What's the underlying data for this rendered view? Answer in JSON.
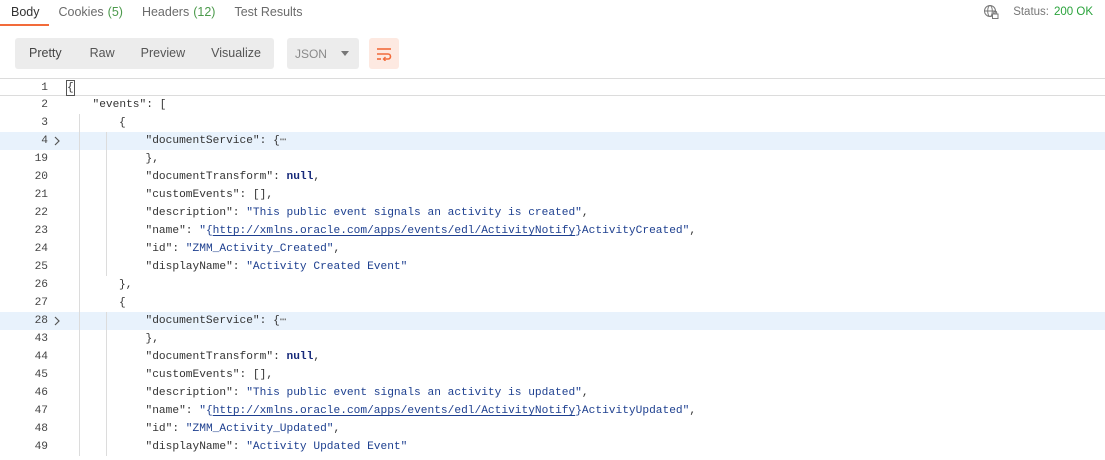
{
  "tabs": [
    {
      "label": "Body",
      "count": "",
      "active": true
    },
    {
      "label": "Cookies",
      "count": "(5)",
      "active": false
    },
    {
      "label": "Headers",
      "count": "(12)",
      "active": false
    },
    {
      "label": "Test Results",
      "count": "",
      "active": false
    }
  ],
  "status": {
    "label": "Status:",
    "value": "200 OK"
  },
  "toolbar": {
    "views": [
      "Pretty",
      "Raw",
      "Preview",
      "Visualize"
    ],
    "format": "JSON",
    "wrap_icon": "wrap-lines-icon"
  },
  "colors": {
    "accent": "#f26b3a",
    "status_ok": "#2aa33c",
    "string": "#1d3f8f",
    "highlight": "#e8f2fc"
  },
  "lines": [
    {
      "num": "1",
      "indent": 0,
      "parts": [
        [
          "cur",
          "{"
        ]
      ]
    },
    {
      "num": "2",
      "indent": 1,
      "parts": [
        [
          "key",
          "\"events\""
        ],
        [
          "p",
          ": ["
        ]
      ]
    },
    {
      "num": "3",
      "indent": 2,
      "parts": [
        [
          "p",
          "{"
        ]
      ]
    },
    {
      "num": "4",
      "indent": 3,
      "fold": true,
      "hl": true,
      "parts": [
        [
          "key",
          "\"documentService\""
        ],
        [
          "p",
          ": {"
        ],
        [
          "ell",
          "⋯"
        ]
      ]
    },
    {
      "num": "19",
      "indent": 3,
      "parts": [
        [
          "p",
          "},"
        ]
      ]
    },
    {
      "num": "20",
      "indent": 3,
      "parts": [
        [
          "key",
          "\"documentTransform\""
        ],
        [
          "p",
          ": "
        ],
        [
          "lit",
          "null"
        ],
        [
          "p",
          ","
        ]
      ]
    },
    {
      "num": "21",
      "indent": 3,
      "parts": [
        [
          "key",
          "\"customEvents\""
        ],
        [
          "p",
          ": [],"
        ]
      ]
    },
    {
      "num": "22",
      "indent": 3,
      "parts": [
        [
          "key",
          "\"description\""
        ],
        [
          "p",
          ": "
        ],
        [
          "str",
          "\"This public event signals an activity is created\""
        ],
        [
          "p",
          ","
        ]
      ]
    },
    {
      "num": "23",
      "indent": 3,
      "parts": [
        [
          "key",
          "\"name\""
        ],
        [
          "p",
          ": "
        ],
        [
          "str",
          "\"{"
        ],
        [
          "url",
          "http://xmlns.oracle.com/apps/events/edl/ActivityNotify"
        ],
        [
          "str",
          "}ActivityCreated\""
        ],
        [
          "p",
          ","
        ]
      ]
    },
    {
      "num": "24",
      "indent": 3,
      "parts": [
        [
          "key",
          "\"id\""
        ],
        [
          "p",
          ": "
        ],
        [
          "str",
          "\"ZMM_Activity_Created\""
        ],
        [
          "p",
          ","
        ]
      ]
    },
    {
      "num": "25",
      "indent": 3,
      "parts": [
        [
          "key",
          "\"displayName\""
        ],
        [
          "p",
          ": "
        ],
        [
          "str",
          "\"Activity Created Event\""
        ]
      ]
    },
    {
      "num": "26",
      "indent": 2,
      "parts": [
        [
          "p",
          "},"
        ]
      ]
    },
    {
      "num": "27",
      "indent": 2,
      "parts": [
        [
          "p",
          "{"
        ]
      ]
    },
    {
      "num": "28",
      "indent": 3,
      "fold": true,
      "hl": true,
      "parts": [
        [
          "key",
          "\"documentService\""
        ],
        [
          "p",
          ": {"
        ],
        [
          "ell",
          "⋯"
        ]
      ]
    },
    {
      "num": "43",
      "indent": 3,
      "parts": [
        [
          "p",
          "},"
        ]
      ]
    },
    {
      "num": "44",
      "indent": 3,
      "parts": [
        [
          "key",
          "\"documentTransform\""
        ],
        [
          "p",
          ": "
        ],
        [
          "lit",
          "null"
        ],
        [
          "p",
          ","
        ]
      ]
    },
    {
      "num": "45",
      "indent": 3,
      "parts": [
        [
          "key",
          "\"customEvents\""
        ],
        [
          "p",
          ": [],"
        ]
      ]
    },
    {
      "num": "46",
      "indent": 3,
      "parts": [
        [
          "key",
          "\"description\""
        ],
        [
          "p",
          ": "
        ],
        [
          "str",
          "\"This public event signals an activity is updated\""
        ],
        [
          "p",
          ","
        ]
      ]
    },
    {
      "num": "47",
      "indent": 3,
      "parts": [
        [
          "key",
          "\"name\""
        ],
        [
          "p",
          ": "
        ],
        [
          "str",
          "\"{"
        ],
        [
          "url",
          "http://xmlns.oracle.com/apps/events/edl/ActivityNotify"
        ],
        [
          "str",
          "}ActivityUpdated\""
        ],
        [
          "p",
          ","
        ]
      ]
    },
    {
      "num": "48",
      "indent": 3,
      "parts": [
        [
          "key",
          "\"id\""
        ],
        [
          "p",
          ": "
        ],
        [
          "str",
          "\"ZMM_Activity_Updated\""
        ],
        [
          "p",
          ","
        ]
      ]
    },
    {
      "num": "49",
      "indent": 3,
      "parts": [
        [
          "key",
          "\"displayName\""
        ],
        [
          "p",
          ": "
        ],
        [
          "str",
          "\"Activity Updated Event\""
        ]
      ]
    }
  ]
}
